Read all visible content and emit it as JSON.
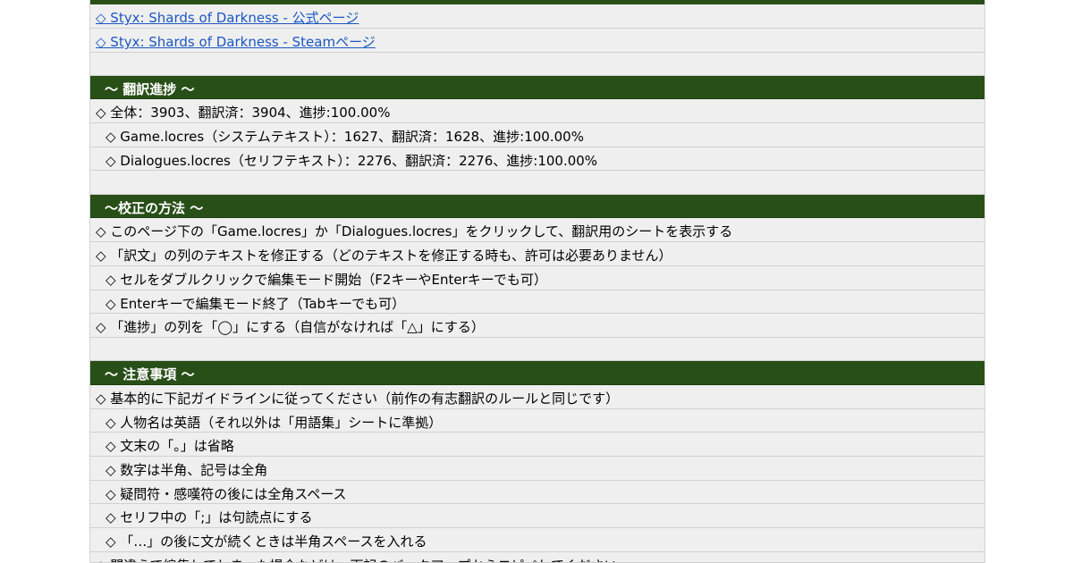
{
  "links": [
    "◇ Styx: Shards of Darkness - 公式ページ",
    "◇ Styx: Shards of Darkness - Steamページ"
  ],
  "progress": {
    "heading": "〜 翻訳進捗 〜",
    "lines": [
      "◇ 全体：3903、翻訳済：3904、進捗:100.00%",
      "◇ Game.locres（システムテキスト）：1627、翻訳済：1628、進捗:100.00%",
      "◇ Dialogues.locres（セリフテキスト）：2276、翻訳済：2276、進捗:100.00%"
    ]
  },
  "proofreading": {
    "heading": "〜校正の方法 〜",
    "lines": [
      "◇ このページ下の「Game.locres」か「Dialogues.locres」をクリックして、翻訳用のシートを表示する",
      "◇ 「訳文」の列のテキストを修正する（どのテキストを修正する時も、許可は必要ありません）",
      "◇ セルをダブルクリックで編集モード開始（F2キーやEnterキーでも可）",
      "◇ Enterキーで編集モード終了（Tabキーでも可）",
      "◇ 「進捗」の列を「◯」にする（自信がなければ「△」にする）"
    ]
  },
  "notes": {
    "heading": "〜 注意事項 〜",
    "lines": [
      "◇ 基本的に下記ガイドラインに従ってください（前作の有志翻訳のルールと同じです）",
      "◇ 人物名は英語（それ以外は「用語集」シートに準拠）",
      "◇ 文末の「。」は省略",
      "◇ 数字は半角、記号は全角",
      "◇ 疑問符・感嘆符の後には全角スペース",
      "◇ セリフ中の「;」は句読点にする",
      "◇ 「…」の後に文が続くときは半角スペースを入れる",
      "◇ 間違えて編集してしまった場合などは、下記のバックアップからコピペしてください"
    ]
  },
  "colors": {
    "header_bg": "#284f17",
    "header_text": "#ffffff",
    "link": "#1a57c4",
    "cell_bg": "#efefef"
  }
}
